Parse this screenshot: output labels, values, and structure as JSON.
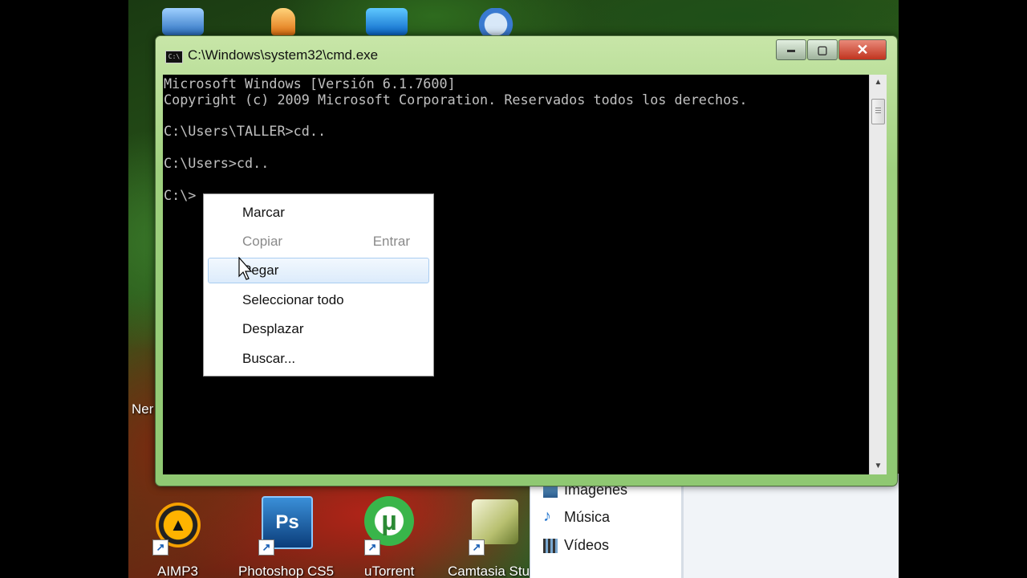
{
  "window": {
    "title": "C:\\Windows\\system32\\cmd.exe",
    "icon_label": "C:\\",
    "minimize_label": "▬",
    "maximize_label": "▢",
    "close_label": "✕"
  },
  "console": {
    "lines": [
      "Microsoft Windows [Versión 6.1.7600]",
      "Copyright (c) 2009 Microsoft Corporation. Reservados todos los derechos.",
      "",
      "C:\\Users\\TALLER>cd..",
      "",
      "C:\\Users>cd..",
      "",
      "C:\\>"
    ],
    "background_color": "#000000",
    "text_color": "#c0c0c0"
  },
  "context_menu": {
    "items": [
      {
        "label": "Marcar",
        "accelerator": "",
        "enabled": true
      },
      {
        "label": "Copiar",
        "accelerator": "Entrar",
        "enabled": false
      },
      {
        "label": "Pegar",
        "accelerator": "",
        "enabled": true,
        "highlighted": true
      },
      {
        "label": "Seleccionar todo",
        "accelerator": "",
        "enabled": true
      },
      {
        "label": "Desplazar",
        "accelerator": "",
        "enabled": true
      },
      {
        "label": "Buscar...",
        "accelerator": "",
        "enabled": true
      }
    ]
  },
  "desktop": {
    "left_label": "Ner",
    "shortcuts": [
      {
        "label": "AIMP3",
        "icon": "aimp-icon"
      },
      {
        "label": "Photoshop CS5",
        "icon": "photoshop-icon",
        "glyph": "Ps"
      },
      {
        "label": "uTorrent",
        "icon": "utorrent-icon",
        "glyph": "µ"
      },
      {
        "label": "Camtasia Stu",
        "icon": "camtasia-icon"
      }
    ]
  },
  "explorer": {
    "items": [
      {
        "label": "Imágenes",
        "icon": "pictures-icon"
      },
      {
        "label": "Música",
        "icon": "music-icon"
      },
      {
        "label": "Vídeos",
        "icon": "videos-icon"
      }
    ]
  },
  "colors": {
    "window_frame": "#9fd07e",
    "menu_highlight": "#dcebfb",
    "close_button": "#c0341f"
  }
}
